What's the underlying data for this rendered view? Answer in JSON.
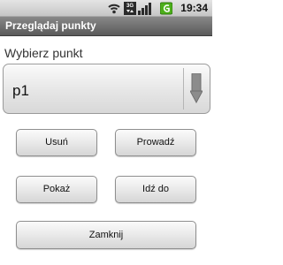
{
  "status_bar": {
    "time": "19:34",
    "icons": [
      "wifi-icon",
      "3g-icon",
      "signal-icon",
      "battery-icon"
    ],
    "network_label": "3G"
  },
  "app": {
    "title": "Przeglądaj punkty"
  },
  "form": {
    "prompt": "Wybierz punkt",
    "spinner_value": "p1"
  },
  "buttons": {
    "usun": "Usuń",
    "prowadz": "Prowadź",
    "pokaz": "Pokaż",
    "idz_do": "Idź do",
    "zamknij": "Zamknij"
  },
  "colors": {
    "title_bar": "#6f6f6f",
    "battery": "#4caf1a"
  }
}
